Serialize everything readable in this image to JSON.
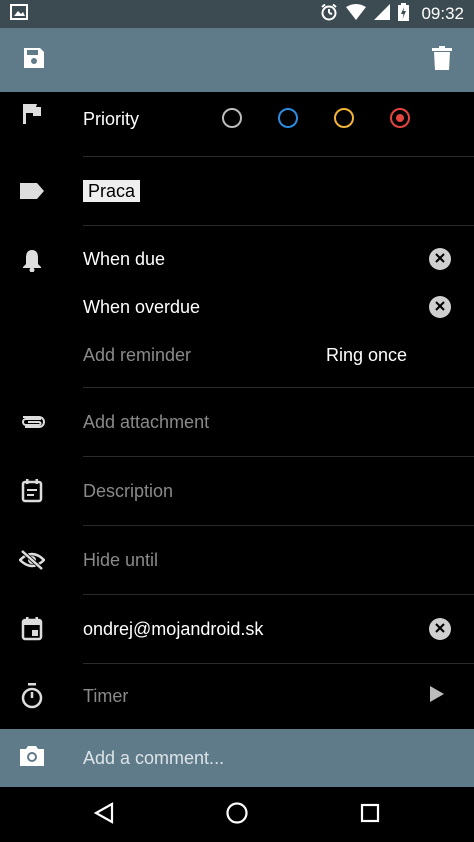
{
  "status": {
    "time": "09:32"
  },
  "priority": {
    "label": "Priority",
    "colors": [
      "#bdbdbd",
      "#2a8be0",
      "#f3b43a",
      "#e6453f"
    ],
    "selected_index": 3
  },
  "tags": {
    "chip": "Praca"
  },
  "reminders": {
    "when_due": "When due",
    "when_overdue": "When overdue",
    "add_reminder": "Add reminder",
    "ring": "Ring once"
  },
  "attachment": {
    "label": "Add attachment"
  },
  "description": {
    "label": "Description"
  },
  "hide_until": {
    "label": "Hide until"
  },
  "calendar": {
    "account": "ondrej@mojandroid.sk"
  },
  "timer": {
    "label": "Timer"
  },
  "comment": {
    "placeholder": "Add a comment..."
  }
}
